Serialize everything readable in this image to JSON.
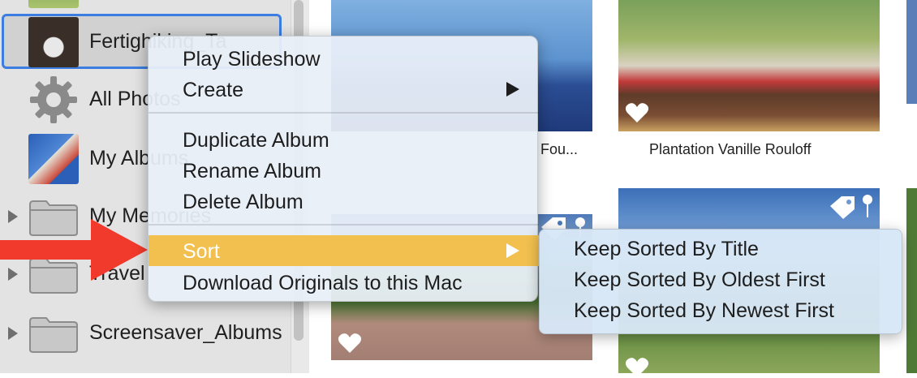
{
  "sidebar": {
    "items": [
      {
        "label": "Fertighiking_Ta",
        "type": "album",
        "selected": true
      },
      {
        "label": "All Photos",
        "type": "smart",
        "icon": "gear-icon"
      },
      {
        "label": "My Albums",
        "type": "album"
      },
      {
        "label": "My Memories",
        "type": "folder"
      },
      {
        "label": "Travel",
        "type": "folder"
      },
      {
        "label": "Screensaver_Albums",
        "type": "folder"
      }
    ]
  },
  "grid": {
    "captions": [
      "Fou...",
      "Plantation Vanille Rouloff"
    ]
  },
  "context_menu": {
    "items": [
      {
        "label": "Play Slideshow",
        "submenu": false
      },
      {
        "label": "Create",
        "submenu": true
      },
      {
        "label": "Duplicate Album",
        "submenu": false
      },
      {
        "label": "Rename Album",
        "submenu": false
      },
      {
        "label": "Delete Album",
        "submenu": false
      },
      {
        "label": "Sort",
        "submenu": true,
        "highlighted": true
      },
      {
        "label": "Download Originals to this Mac",
        "submenu": false
      }
    ],
    "sort_submenu": [
      "Keep Sorted By Title",
      "Keep Sorted By Oldest First",
      "Keep Sorted By Newest First"
    ]
  },
  "colors": {
    "highlight": "#f1c04f",
    "selection_border": "#3b7de0",
    "annotation_arrow": "#f23a2c"
  }
}
